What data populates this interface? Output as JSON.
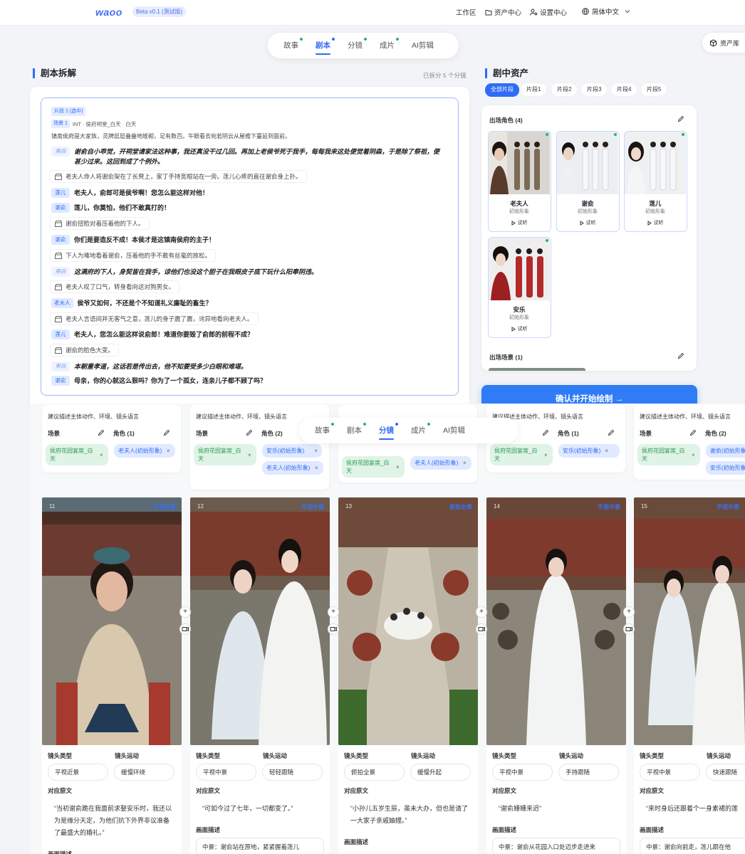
{
  "header": {
    "logo": "waoo",
    "beta": "Beta v0.1 (测试版)",
    "workspace": "工作区",
    "assets": "资产中心",
    "settings": "设置中心",
    "language": "简体中文"
  },
  "tabs_top": {
    "items": [
      "故事",
      "剧本",
      "分镜",
      "成片",
      "AI剪辑"
    ],
    "active": "剧本"
  },
  "asset_lib": "资产库",
  "script": {
    "title": "剧本拆解",
    "status": "已拆分 5 个分镜",
    "segment_tag": "片段 1 (选中)",
    "scene_tag": "场景 1",
    "scene_info": "INT · 侯府祠堂_白天 · 白天",
    "intro": "镇南侯府是大家族，灵牌层层叠叠地堆砌，足有数百。午眼看去宛若阴云从屋檐下蔓延到面前。",
    "narration_label": "旁白",
    "lines": [
      {
        "speaker": "旁白",
        "text": "谢俞自小乖觉，开祠堂请家法这种事，我还真没干过几回。再加上老侯爷死于我手，每每我来这处便觉着阴森，于是除了祭祖，便甚少过来。这回到成了个例外。"
      },
      {
        "action": "老夫人命人将谢俞架在了长凳上，家丁手持宽棍站在一旁。莲儿心疼的直往谢俞身上扑。"
      },
      {
        "speaker": "莲儿",
        "text": "老夫人，俞郎可是侯爷啊！您怎么能这样对他！"
      },
      {
        "speaker": "谢俞",
        "text": "莲儿，你莫怕，他们不敢真打的！"
      },
      {
        "action": "谢俞扭脸对着压着他的下人。"
      },
      {
        "speaker": "谢俞",
        "text": "你们是要造反不成！本侯才是这镇南侯府的主子！"
      },
      {
        "action": "下人为难地看着谢俞，压着他的手不敢有丝毫的放松。"
      },
      {
        "speaker": "旁白",
        "text": "这满府的下人，身契皆在我手，谅他们也没这个胆子在我眼皮子底下玩什么阳奉阴违。"
      },
      {
        "action": "老夫人叹了口气，转身看向这对狗男女。"
      },
      {
        "speaker": "老夫人",
        "text": "侯爷又如何，不还是个不知道礼义廉耻的畜生？"
      },
      {
        "action": "老夫人言语间并无客气之意，莲儿的身子震了震，诧异地看向老夫人。"
      },
      {
        "speaker": "莲儿",
        "text": "老夫人，您怎么能这样说俞郎！难道你要毁了俞郎的前程不成？"
      },
      {
        "action": "谢俞的脸色大变。"
      },
      {
        "speaker": "旁白",
        "text": "本朝重孝道，这话若是传出去，他不知要受多少白眼和难堪。"
      },
      {
        "speaker": "谢俞",
        "text": "母亲，你的心就这么狠吗？你为了一个孤女，连亲儿子都不顾了吗？"
      }
    ]
  },
  "assets": {
    "title": "剧中资产",
    "filters": [
      "全部片段",
      "片段1",
      "片段2",
      "片段3",
      "片段4",
      "片段5"
    ],
    "characters_title": "出场角色 (4)",
    "characters": [
      {
        "name": "老夫人",
        "desc": "初始形象",
        "audio": "试听"
      },
      {
        "name": "谢俞",
        "desc": "初始形象",
        "audio": "试听"
      },
      {
        "name": "莲儿",
        "desc": "初始形象",
        "audio": "试听"
      },
      {
        "name": "安乐",
        "desc": "初始形象",
        "audio": "试听"
      }
    ],
    "scenes_title": "出场场景 (1)",
    "confirm": "确认并开始绘制 →"
  },
  "tabs_bottom": {
    "items": [
      "故事",
      "剧本",
      "分镜",
      "成片",
      "AI剪辑"
    ],
    "active": "分镜"
  },
  "storyboard": {
    "hint": "建议描述主体动作、环境、镜头语言",
    "scene_label": "场景",
    "role_label": "角色",
    "cards": [
      {
        "roles_count": "角色 (1)",
        "scene_chip": "侯府花园宴席_白天",
        "role_chips": [
          "老夫人(初始形象)"
        ]
      },
      {
        "roles_count": "角色 (2)",
        "scene_chip": "侯府花园宴席_白天",
        "role_chips": [
          "安乐(初始形象)",
          "老夫人(初始形象)"
        ]
      },
      {
        "roles_count": "",
        "scene_chip": "侯府花园宴席_白天",
        "role_chips": [
          "老夫人(初始形象)"
        ]
      },
      {
        "roles_count": "角色 (1)",
        "scene_chip": "侯府花园宴席_白天",
        "role_chips": [
          "安乐(初始形象)"
        ]
      },
      {
        "roles_count": "角色 (2)",
        "scene_chip": "侯府花园宴席_白天",
        "role_chips": [
          "谢俞(初始形象)",
          "安乐(初始形象)"
        ]
      }
    ],
    "shot_type_label": "镜头类型",
    "shot_move_label": "镜头运动",
    "orig_label": "对应原文",
    "desc_label": "画面描述",
    "shots": [
      {
        "num": "11",
        "tag": "平视近景",
        "type": "平视近景",
        "move": "缓慢环绕",
        "quote": "“当初谢俞跪在我面前求娶安乐时，我还以为是缘分天定，为他们抗下外界非议准备了最盛大的婚礼。”",
        "desc": ""
      },
      {
        "num": "12",
        "tag": "平视中景",
        "type": "平视中景",
        "move": "轻轻跟随",
        "quote": "“可如今过了七年，一切都变了。”",
        "desc": "中景：谢俞站在原地，紧紧握着莲儿"
      },
      {
        "num": "13",
        "tag": "俯拍全景",
        "type": "俯拍全景",
        "move": "缓慢升起",
        "quote": "“小孙儿五岁生辰，虽未大办，但也是请了一大家子亲戚妯娌。”",
        "desc": ""
      },
      {
        "num": "14",
        "tag": "平视中景",
        "type": "平视中景",
        "move": "手持跟随",
        "quote": "“谢俞姗姗来迟”",
        "desc": "中景：谢俞从花园入口处迈步走进来"
      },
      {
        "num": "15",
        "tag": "平视中景",
        "type": "平视中景",
        "move": "快速跟随",
        "quote": "“来时身后还跟着个一身素裙的莲",
        "desc": "中景：谢俞向前走，莲儿跟在他"
      }
    ]
  }
}
